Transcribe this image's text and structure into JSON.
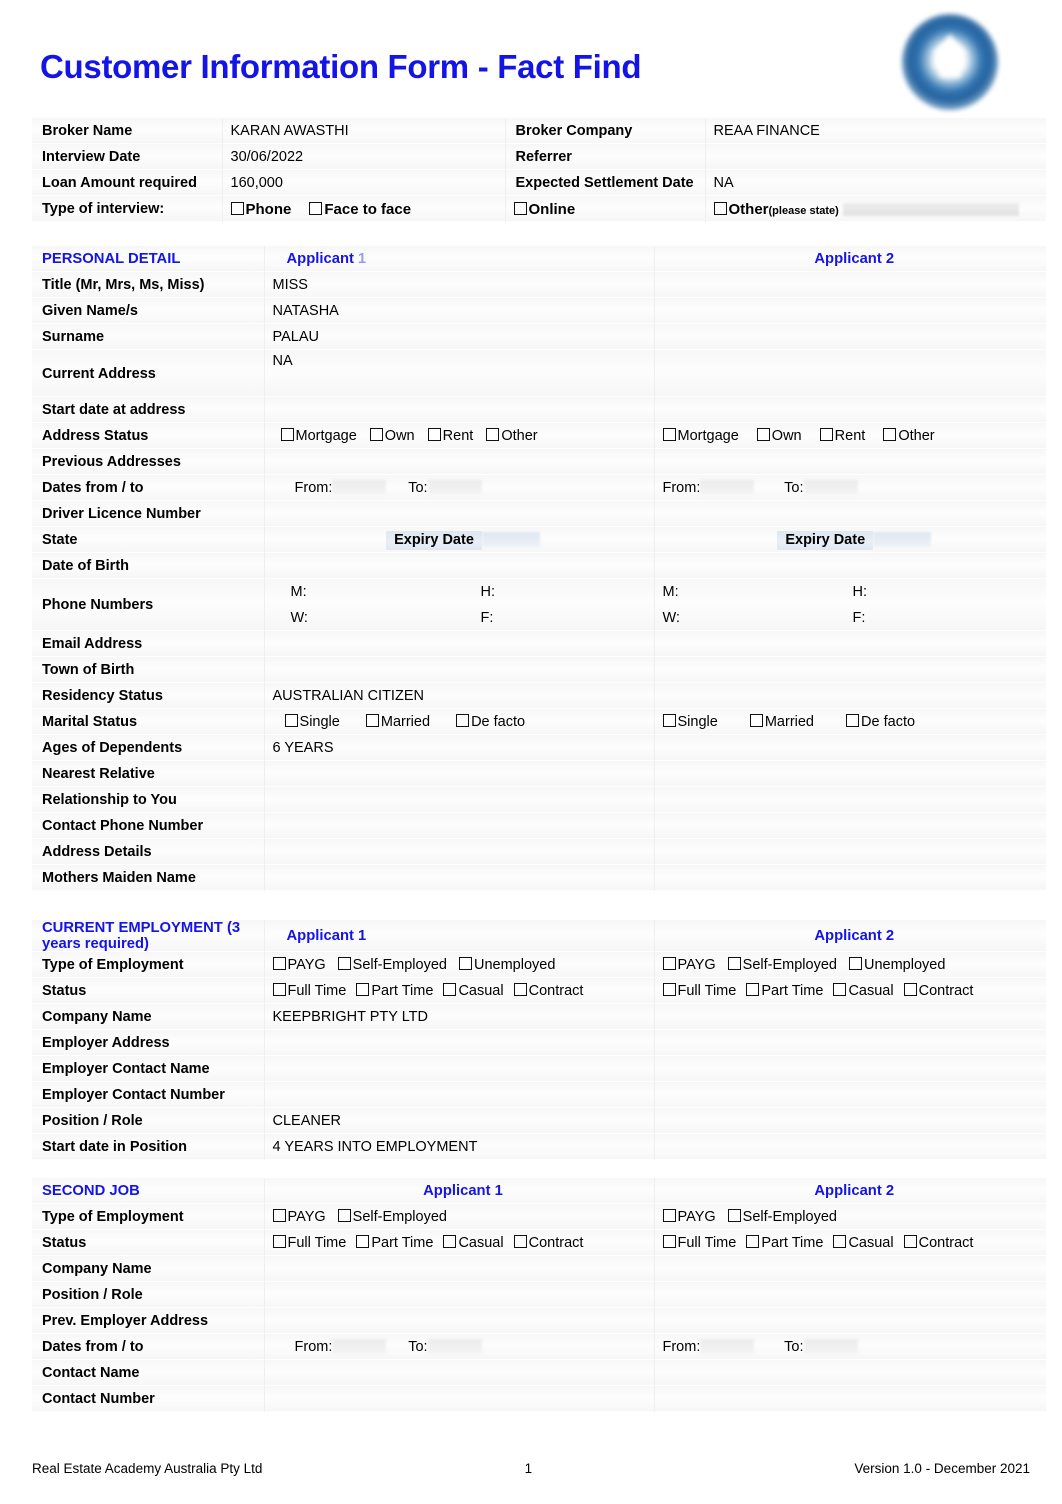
{
  "document": {
    "title": "Customer Information Form - Fact Find",
    "accent_color": "#1414E6",
    "logo_name": "reaa-logo"
  },
  "broker": {
    "rows": [
      {
        "label": "Broker Name",
        "value": "KARAN AWASTHI",
        "label2": "Broker Company",
        "value2": "REAA FINANCE"
      },
      {
        "label": "Interview Date",
        "value": "30/06/2022",
        "label2": "Referrer",
        "value2": ""
      },
      {
        "label": "Loan Amount required",
        "value": "160,000",
        "label2": "Expected Settlement Date",
        "value2": "NA"
      }
    ],
    "interview_label": "Type of interview:",
    "interview_options": [
      "Phone",
      "Face to face",
      "Online",
      "Other"
    ],
    "interview_other_hint": "(please state)"
  },
  "personal": {
    "section_title": "PERSONAL DETAIL",
    "col1_header": "Applicant",
    "col1_header_suffix": "1",
    "col2_header": "Applicant 2",
    "rows": [
      {
        "label": "Title (Mr, Mrs, Ms, Miss)",
        "a1": "MISS",
        "a2": ""
      },
      {
        "label": "Given Name/s",
        "a1": "NATASHA",
        "a2": ""
      },
      {
        "label": "Surname",
        "a1": "PALAU",
        "a2": ""
      },
      {
        "label": "Current Address",
        "a1": "NA",
        "a2": ""
      },
      {
        "label": "Start date at address",
        "a1": "",
        "a2": ""
      },
      {
        "label": "Address Status",
        "a1": "",
        "a2": "",
        "type": "checkboxes",
        "options": [
          "Mortgage",
          "Own",
          "Rent",
          "Other"
        ]
      },
      {
        "label": "Previous Addresses",
        "a1": "",
        "a2": ""
      },
      {
        "label": "Dates from / to",
        "a1": "",
        "a2": "",
        "type": "fromto",
        "from_label": "From:",
        "to_label": "To:"
      },
      {
        "label": "Driver Licence Number",
        "a1": "",
        "a2": ""
      },
      {
        "label": "State",
        "a1": "",
        "a2": "",
        "type": "expiry",
        "expiry_label": "Expiry Date"
      },
      {
        "label": "Date of Birth",
        "a1": "",
        "a2": ""
      },
      {
        "label": "Phone Numbers",
        "a1": "",
        "a2": "",
        "type": "phones",
        "phone_labels": [
          "M:",
          "H:",
          "W:",
          "F:"
        ]
      },
      {
        "label": "Email Address",
        "a1": "",
        "a2": ""
      },
      {
        "label": "Town of Birth",
        "a1": "",
        "a2": ""
      },
      {
        "label": "Residency Status",
        "a1": "AUSTRALIAN CITIZEN",
        "a2": ""
      },
      {
        "label": "Marital Status",
        "a1": "",
        "a2": "",
        "type": "checkboxes",
        "options": [
          "Single",
          "Married",
          "De facto"
        ]
      },
      {
        "label": "Ages of Dependents",
        "a1": "6 YEARS",
        "a2": ""
      },
      {
        "label": "Nearest Relative",
        "a1": "",
        "a2": ""
      },
      {
        "label": "Relationship to You",
        "a1": "",
        "a2": ""
      },
      {
        "label": "Contact Phone Number",
        "a1": "",
        "a2": ""
      },
      {
        "label": "Address Details",
        "a1": "",
        "a2": ""
      },
      {
        "label": "Mothers Maiden Name",
        "a1": "",
        "a2": ""
      }
    ]
  },
  "current_employment": {
    "section_title": "CURRENT EMPLOYMENT (3 years required)",
    "col1_header": "Applicant 1",
    "col2_header": "Applicant 2",
    "rows": [
      {
        "label": "Type of Employment",
        "a1": "",
        "a2": "",
        "type": "checkboxes",
        "options": [
          "PAYG",
          "Self-Employed",
          "Unemployed"
        ]
      },
      {
        "label": "Status",
        "a1": "",
        "a2": "",
        "type": "checkboxes",
        "options": [
          "Full Time",
          "Part Time",
          "Casual",
          "Contract"
        ]
      },
      {
        "label": "Company Name",
        "a1": "KEEPBRIGHT PTY LTD",
        "a2": ""
      },
      {
        "label": "Employer Address",
        "a1": "",
        "a2": ""
      },
      {
        "label": "Employer Contact Name",
        "a1": "",
        "a2": ""
      },
      {
        "label": "Employer Contact Number",
        "a1": "",
        "a2": ""
      },
      {
        "label": "Position / Role",
        "a1": "CLEANER",
        "a2": ""
      },
      {
        "label": "Start date in Position",
        "a1": "4 YEARS INTO EMPLOYMENT",
        "a2": ""
      }
    ]
  },
  "second_job": {
    "section_title": "SECOND JOB",
    "col1_header": "Applicant 1",
    "col2_header": "Applicant 2",
    "rows": [
      {
        "label": "Type of Employment",
        "a1": "",
        "a2": "",
        "type": "checkboxes",
        "options": [
          "PAYG",
          "Self-Employed"
        ]
      },
      {
        "label": "Status",
        "a1": "",
        "a2": "",
        "type": "checkboxes",
        "options": [
          "Full Time",
          "Part Time",
          "Casual",
          "Contract"
        ]
      },
      {
        "label": "Company Name",
        "a1": "",
        "a2": ""
      },
      {
        "label": "Position / Role",
        "a1": "",
        "a2": ""
      },
      {
        "label": "Prev. Employer Address",
        "a1": "",
        "a2": ""
      },
      {
        "label": "Dates from / to",
        "a1": "",
        "a2": "",
        "type": "fromto",
        "from_label": "From:",
        "to_label": "To:"
      },
      {
        "label": "Contact Name",
        "a1": "",
        "a2": ""
      },
      {
        "label": "Contact Number",
        "a1": "",
        "a2": ""
      }
    ]
  },
  "footer": {
    "company": "Real Estate Academy Australia Pty Ltd",
    "page_number": "1",
    "version": "Version 1.0 - December 2021"
  }
}
